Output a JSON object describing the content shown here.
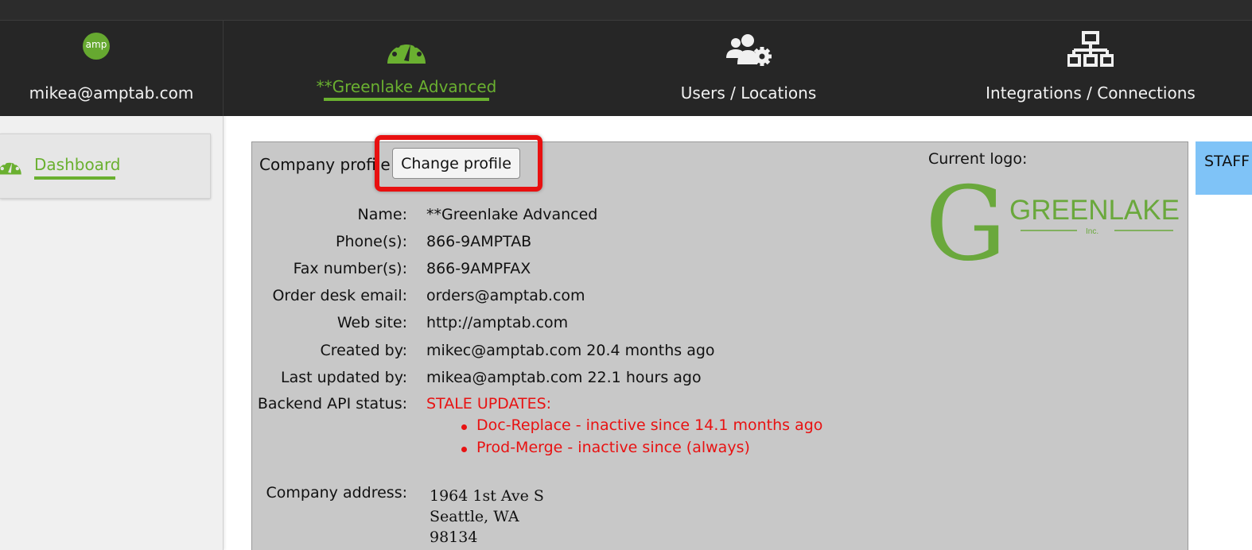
{
  "nav": {
    "user_email": "mikea@amptab.com",
    "logo_text": "amp",
    "items": [
      {
        "label": "**Greenlake Advanced",
        "active": true,
        "icon": "dashboard-gauge-icon"
      },
      {
        "label": "Users / Locations",
        "active": false,
        "icon": "users-gear-icon"
      },
      {
        "label": "Integrations / Connections",
        "active": false,
        "icon": "network-icon"
      }
    ],
    "accent_color": "#6ab030"
  },
  "sidebar": {
    "items": [
      {
        "label": "Dashboard",
        "icon": "dashboard-gauge-icon",
        "active": true
      }
    ]
  },
  "profile": {
    "heading": "Company profile",
    "change_button": "Change profile",
    "fields": [
      {
        "label": "Name:",
        "value": "**Greenlake Advanced"
      },
      {
        "label": "Phone(s):",
        "value": "866-9AMPTAB"
      },
      {
        "label": "Fax number(s):",
        "value": "866-9AMPFAX"
      },
      {
        "label": "Order desk email:",
        "value": "orders@amptab.com"
      },
      {
        "label": "Web site:",
        "value": "http://amptab.com"
      },
      {
        "label": "Created by:",
        "value": "mikec@amptab.com 20.4 months ago"
      },
      {
        "label": "Last updated by:",
        "value": "mikea@amptab.com 22.1 hours ago"
      }
    ],
    "api_status": {
      "label": "Backend API status:",
      "value": "STALE UPDATES:",
      "items": [
        "Doc-Replace - inactive since 14.1 months ago",
        "Prod-Merge - inactive since (always)"
      ],
      "color": "#e81212"
    },
    "address": {
      "label": "Company address:",
      "lines": [
        "1964 1st Ave S",
        "Seattle, WA",
        "98134"
      ]
    },
    "logo": {
      "label": "Current logo:",
      "big_letter": "G",
      "word": "GREENLAKE",
      "suffix": "Inc.",
      "color": "#6aa83c"
    }
  },
  "staff_tab": {
    "label": "STAFF"
  }
}
